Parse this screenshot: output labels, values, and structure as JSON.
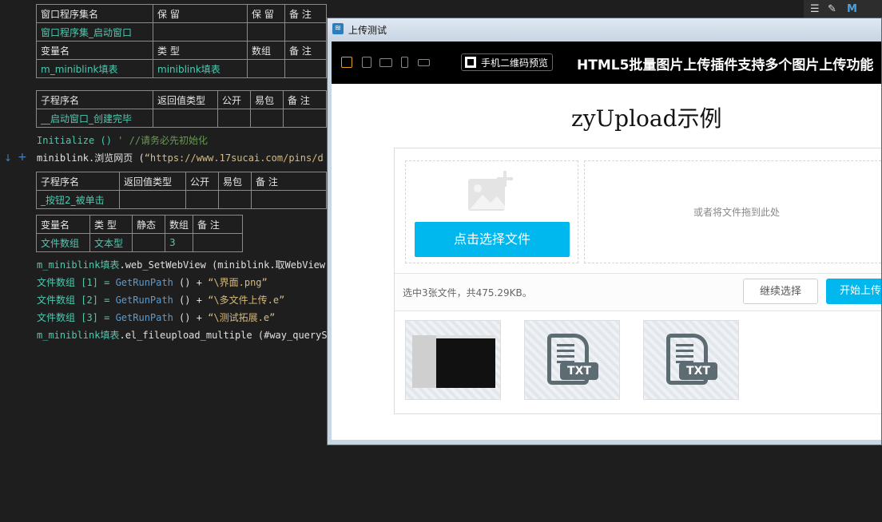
{
  "editor": {
    "table1": {
      "headers": [
        "窗口程序集名",
        "保 留",
        "保 留",
        "备 注"
      ],
      "row": [
        "窗口程序集_启动窗口",
        "",
        "",
        ""
      ]
    },
    "table2": {
      "headers": [
        "变量名",
        "类 型",
        "数组",
        "备 注"
      ],
      "row": [
        "m_miniblink填表",
        "miniblink填表",
        "",
        ""
      ]
    },
    "table3": {
      "headers": [
        "子程序名",
        "返回值类型",
        "公开",
        "易包",
        "备 注"
      ],
      "row": [
        "__启动窗口_创建完毕",
        "",
        "",
        "",
        ""
      ]
    },
    "line_init_code": "Initialize ()",
    "line_init_comment": "' //请务必先初始化",
    "line_browse_obj": "miniblink.浏览网页 (",
    "line_browse_str": "“https://www.17sucai.com/pins/d",
    "table4": {
      "headers": [
        "子程序名",
        "返回值类型",
        "公开",
        "易包",
        "备 注"
      ],
      "row": [
        "_按钮2_被单击",
        "",
        "",
        "",
        ""
      ]
    },
    "table5": {
      "headers": [
        "变量名",
        "类 型",
        "静态",
        "数组",
        "备 注"
      ],
      "row": [
        "文件数组",
        "文本型",
        "",
        "3",
        ""
      ]
    },
    "line_setwebview_a": "m_miniblink填表",
    "line_setwebview_b": ".web_SetWebView (miniblink.取WebView",
    "line_f1_a": "文件数组 [1] = ",
    "line_f1_b": "GetRunPath",
    "line_f1_c": " () + ",
    "line_f1_d": " “\\界面.png”",
    "line_f2_a": "文件数组 [2] = ",
    "line_f2_b": "GetRunPath",
    "line_f2_c": " () + ",
    "line_f2_d": " “\\多文件上传.e”",
    "line_f3_a": "文件数组 [3] = ",
    "line_f3_b": "GetRunPath",
    "line_f3_c": " () + ",
    "line_f3_d": " “\\测试拓展.e”",
    "line_upload_a": "m_miniblink填表",
    "line_upload_b": ".el_fileupload_multiple (#way_querySe"
  },
  "window": {
    "title": "上传测试",
    "qr_label": "手机二维码预览",
    "headline": "HTML5批量图片上传插件支持多个图片上传功能",
    "demo_title": "zyUpload示例",
    "pick_button": "点击选择文件",
    "drop_hint": "或者将文件拖到此处",
    "status": "选中3张文件，共475.29KB。",
    "continue_button": "继续选择",
    "start_button": "开始上传",
    "thumb_badge_1": "TXT",
    "thumb_badge_2": "TXT"
  }
}
